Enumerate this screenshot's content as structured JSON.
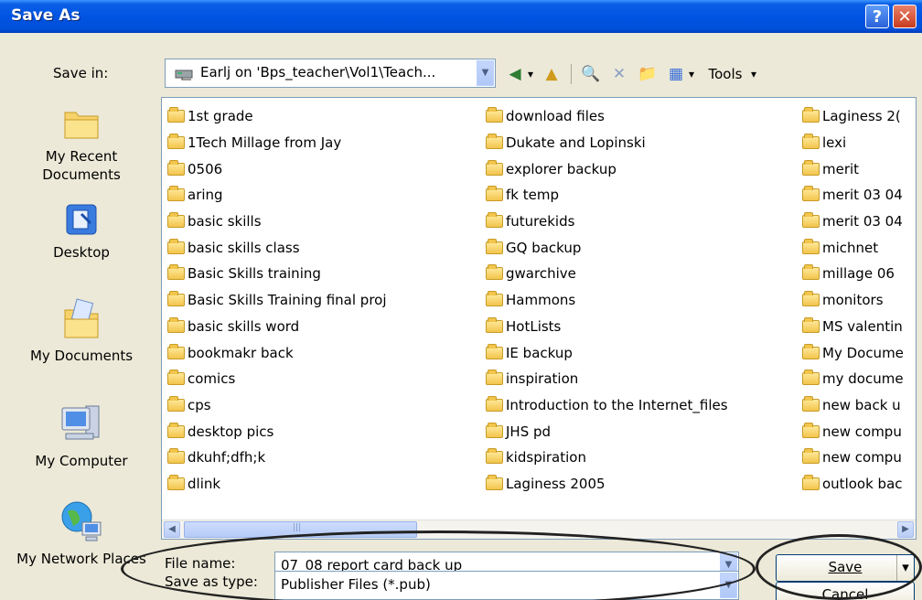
{
  "window": {
    "title": "Save As",
    "help_label": "?",
    "close_label": "✕"
  },
  "toolbar": {
    "save_in_label": "Save in:",
    "location": "Earlj on 'Bps_teacher\\Vol1\\Teach...",
    "back_label": "◀",
    "up_label": "▲",
    "search_label": "🔍",
    "delete_label": "✕",
    "new_folder_label": "📁",
    "views_label": "▦",
    "tools_label": "Tools",
    "dropdown_arrow": "▾",
    "location_arrow": "▼"
  },
  "places": [
    {
      "label": "My Recent Documents",
      "icon": "recent-documents-icon"
    },
    {
      "label": "Desktop",
      "icon": "desktop-icon"
    },
    {
      "label": "My Documents",
      "icon": "my-documents-icon"
    },
    {
      "label": "My Computer",
      "icon": "my-computer-icon"
    },
    {
      "label": "My Network Places",
      "icon": "network-places-icon"
    }
  ],
  "files": {
    "col1": [
      "1st grade",
      "1Tech Millage from Jay",
      "0506",
      "aring",
      "basic skills",
      "basic skills class",
      "Basic Skills training",
      "Basic Skills Training final proj",
      "basic skills word",
      "bookmakr back",
      "comics",
      "cps",
      "desktop pics",
      "dkuhf;dfh;k",
      "dlink"
    ],
    "col2": [
      "download files",
      "Dukate and Lopinski",
      "explorer backup",
      "fk temp",
      "futurekids",
      "GQ backup",
      "gwarchive",
      "Hammons",
      "HotLists",
      "IE backup",
      "inspiration",
      "Introduction to the Internet_files",
      "JHS pd",
      "kidspiration",
      "Laginess 2005"
    ],
    "col3": [
      "Laginess 2(",
      "lexi",
      "merit",
      "merit 03 04",
      "merit 03 04",
      "michnet",
      "millage 06",
      "monitors",
      "MS valentin",
      "My Docume",
      "my docume",
      "new back u",
      "new compu",
      "new compu",
      "outlook bac"
    ]
  },
  "scroll": {
    "left_arrow": "◀",
    "right_arrow": "▶",
    "thumb_grip": "|||"
  },
  "filename": {
    "label": "File name:",
    "value": "07_08 report card back up"
  },
  "filetype": {
    "label": "Save as type:",
    "value": "Publisher Files (*.pub)"
  },
  "buttons": {
    "save_label": "Save",
    "save_arrow": "▾",
    "cancel_label": "Cancel"
  },
  "colors": {
    "titlebar": "#0054e3",
    "dialog_bg": "#ece9d8",
    "border_blue": "#7f9db9"
  }
}
